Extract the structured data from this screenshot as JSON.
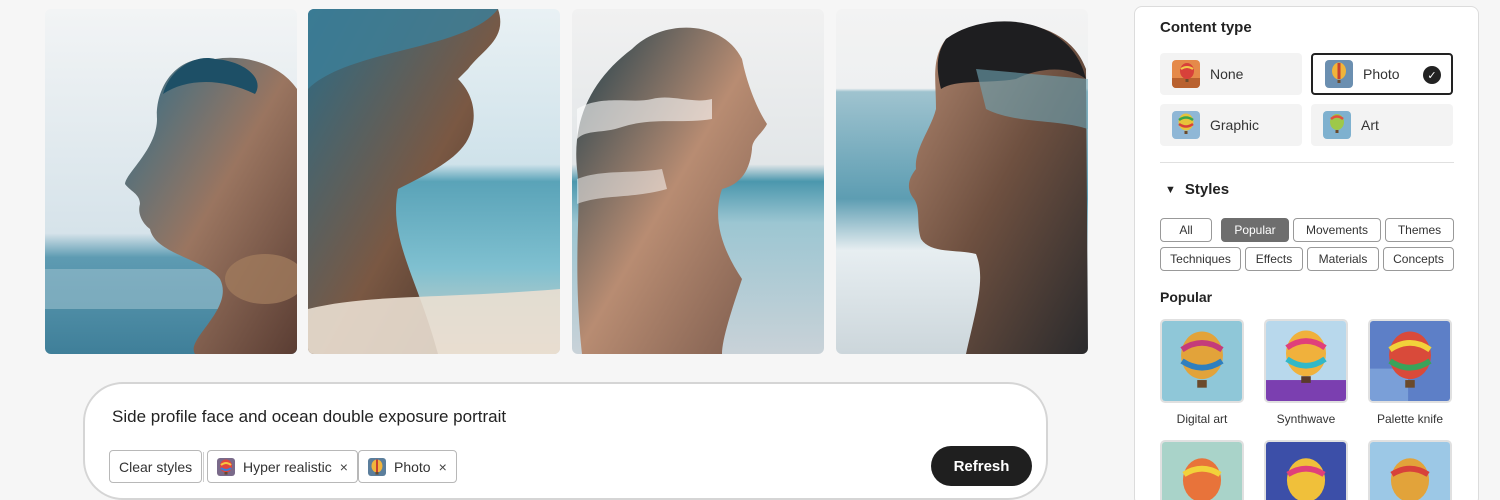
{
  "gallery": {
    "images": [
      {
        "name": "result-image-1"
      },
      {
        "name": "result-image-2"
      },
      {
        "name": "result-image-3"
      },
      {
        "name": "result-image-4"
      }
    ]
  },
  "prompt": {
    "text": "Side profile face and ocean double exposure portrait",
    "clear_styles_label": "Clear styles",
    "chips": [
      {
        "label": "Hyper realistic",
        "remove": "×"
      },
      {
        "label": "Photo",
        "remove": "×"
      }
    ],
    "refresh_label": "Refresh"
  },
  "panel": {
    "content_type_title": "Content type",
    "content_types": [
      {
        "label": "None",
        "selected": false
      },
      {
        "label": "Photo",
        "selected": true
      },
      {
        "label": "Graphic",
        "selected": false
      },
      {
        "label": "Art",
        "selected": false
      }
    ],
    "check_glyph": "✓",
    "styles_title": "Styles",
    "chevron_glyph": "▼",
    "style_tags": [
      "All",
      "Popular",
      "Movements",
      "Themes",
      "Techniques",
      "Effects",
      "Materials",
      "Concepts"
    ],
    "active_tag": "Popular",
    "popular_title": "Popular",
    "popular_styles": [
      {
        "label": "Digital art"
      },
      {
        "label": "Synthwave"
      },
      {
        "label": "Palette knife"
      }
    ]
  },
  "colors": {
    "refresh_bg": "#1f1f1f",
    "active_tag_bg": "#6e6e6e",
    "page_bg": "#f6f6f6"
  }
}
